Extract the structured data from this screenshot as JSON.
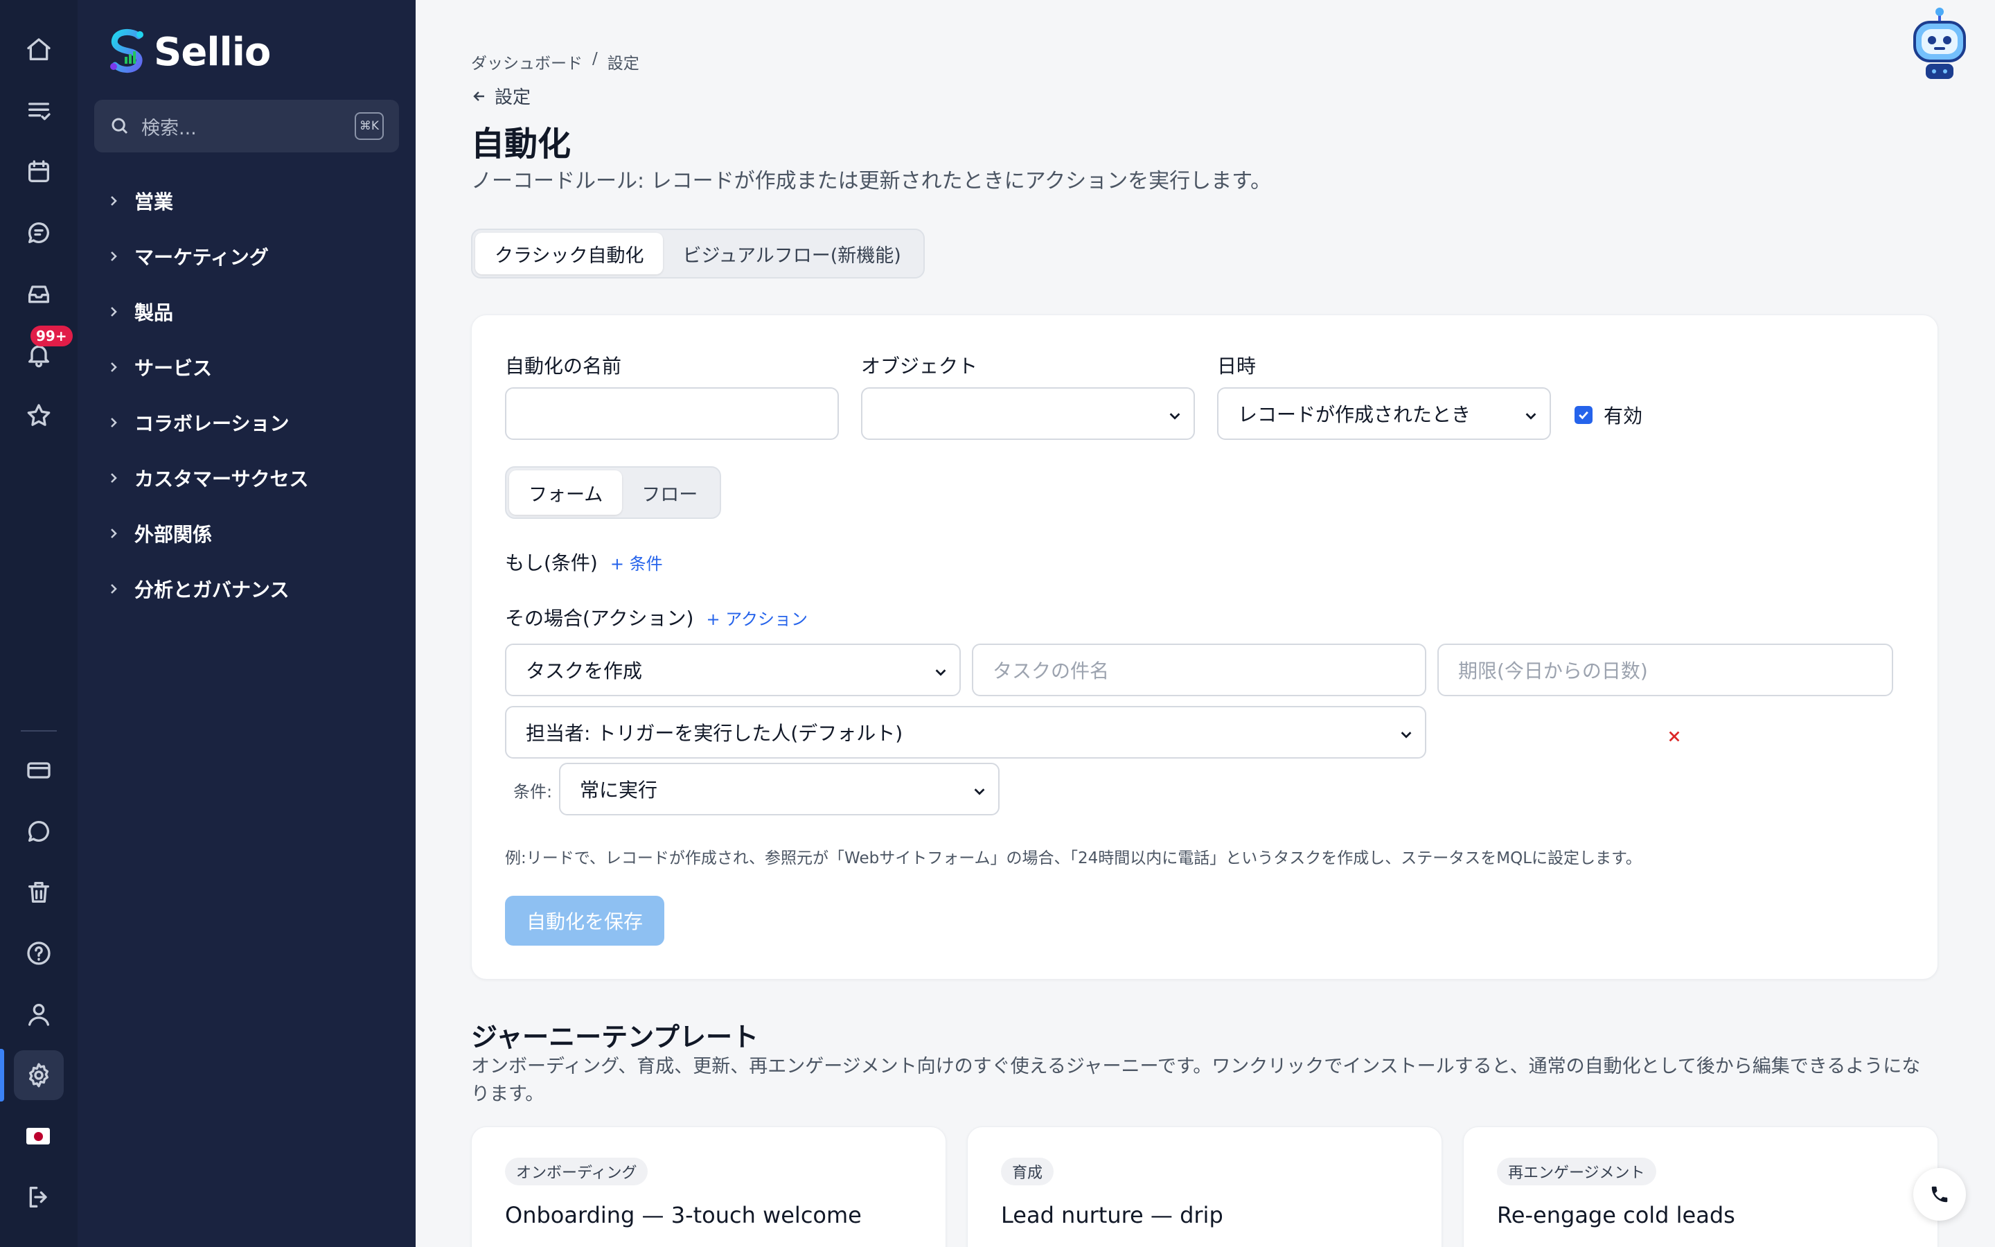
{
  "app": {
    "name": "Sellio"
  },
  "search": {
    "placeholder": "検索...",
    "shortcut": "⌘K"
  },
  "rail": {
    "notification_badge": "99+"
  },
  "sidebar": {
    "items": [
      {
        "label": "営業"
      },
      {
        "label": "マーケティング"
      },
      {
        "label": "製品"
      },
      {
        "label": "サービス"
      },
      {
        "label": "コラボレーション"
      },
      {
        "label": "カスタマーサクセス"
      },
      {
        "label": "外部関係"
      },
      {
        "label": "分析とガバナンス"
      }
    ]
  },
  "breadcrumb": {
    "home": "ダッシュボード",
    "separator": "/",
    "current": "設定"
  },
  "back": {
    "label": "設定"
  },
  "page": {
    "title": "自動化",
    "subtitle": "ノーコードルール: レコードが作成または更新されたときにアクションを実行します。"
  },
  "tabs": [
    {
      "label": "クラシック自動化",
      "active": true
    },
    {
      "label": "ビジュアルフロー(新機能)",
      "active": false
    }
  ],
  "form": {
    "name_label": "自動化の名前",
    "name_value": "",
    "object_label": "オブジェクト",
    "object_value": "",
    "when_label": "日時",
    "when_value": "レコードが作成されたとき",
    "enabled_label": "有効",
    "mode_tabs": [
      {
        "label": "フォーム",
        "active": true
      },
      {
        "label": "フロー",
        "active": false
      }
    ],
    "if_label": "もし(条件)",
    "add_condition": "+ 条件",
    "then_label": "その場合(アクション)",
    "add_action": "+ アクション",
    "action_type": "タスクを作成",
    "task_subject_placeholder": "タスクの件名",
    "due_placeholder": "期限(今日からの日数)",
    "assignee": "担当者: トリガーを実行した人(デフォルト)",
    "condition_label": "条件:",
    "condition_value": "常に実行",
    "example": "例:リードで、レコードが作成され、参照元が「Webサイトフォーム」の場合、「24時間以内に電話」というタスクを作成し、ステータスをMQLに設定します。",
    "save_label": "自動化を保存"
  },
  "journeys": {
    "title": "ジャーニーテンプレート",
    "subtitle": "オンボーディング、育成、更新、再エンゲージメント向けのすぐ使えるジャーニーです。ワンクリックでインストールすると、通常の自動化として後から編集できるようになります。",
    "templates": [
      {
        "badge": "オンボーディング",
        "name": "Onboarding — 3-touch welcome"
      },
      {
        "badge": "育成",
        "name": "Lead nurture — drip"
      },
      {
        "badge": "再エンゲージメント",
        "name": "Re-engage cold leads"
      }
    ]
  },
  "icons": {
    "rail": [
      "home-icon",
      "tasks-icon",
      "calendar-icon",
      "chat-icon",
      "inbox-icon",
      "bell-icon",
      "star-icon",
      "billing-icon",
      "message-icon",
      "trash-icon",
      "help-icon",
      "user-icon",
      "gear-icon",
      "flag-jp-icon",
      "logout-icon"
    ]
  },
  "colors": {
    "accent": "#2563eb",
    "rail_bg": "#161f38",
    "sidebar_bg": "#1a2340",
    "save_button": "#8ec0f2",
    "badge": "#e11d48"
  }
}
